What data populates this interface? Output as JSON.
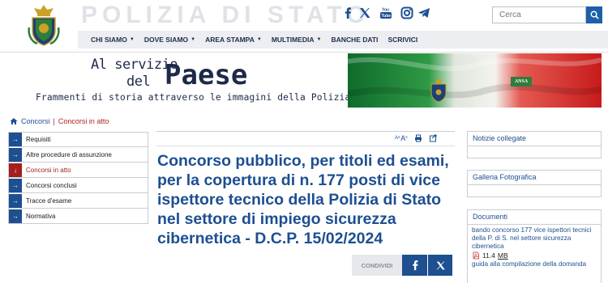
{
  "header": {
    "site_title": "POLIZIA DI STATO",
    "social_icons": [
      "facebook-icon",
      "x-icon",
      "youtube-icon",
      "instagram-icon",
      "telegram-icon"
    ],
    "search": {
      "placeholder": "Cerca"
    },
    "nav": [
      {
        "label": "CHI SIAMO",
        "dropdown": true
      },
      {
        "label": "DOVE SIAMO",
        "dropdown": true
      },
      {
        "label": "AREA STAMPA",
        "dropdown": true
      },
      {
        "label": "MULTIMEDIA",
        "dropdown": true
      },
      {
        "label": "BANCHE DATI",
        "dropdown": false
      },
      {
        "label": "SCRIVICI",
        "dropdown": false
      }
    ]
  },
  "banner": {
    "line1": "Al servizio",
    "line2_small": "del",
    "line2_big": "Paese",
    "line3": "Frammenti di storia attraverso le immagini della Polizia",
    "badge": "ANSA"
  },
  "breadcrumb": {
    "home_icon": "home-icon",
    "items": [
      "Concorsi",
      "Concorsi in atto"
    ]
  },
  "sidebar": {
    "items": [
      {
        "label": "Requisiti",
        "active": false
      },
      {
        "label": "Altre procedure di assunzione",
        "active": false
      },
      {
        "label": "Concorsi in atto",
        "active": true
      },
      {
        "label": "Concorsi conclusi",
        "active": false
      },
      {
        "label": "Tracce d'esame",
        "active": false
      },
      {
        "label": "Normativa",
        "active": false
      }
    ]
  },
  "main": {
    "tools": {
      "font_small": "A",
      "font_large": "A",
      "print_icon": "print-icon",
      "share_icon": "share-icon"
    },
    "title": "Concorso pubblico, per titoli ed esami, per la copertura di n. 177 posti di vice ispettore tecnico della Polizia di Stato nel settore di impiego sicurezza cibernetica - D.C.P. 15/02/2024",
    "share_label": "CONDIVIDI"
  },
  "right": {
    "related_title": "Notizie collegate",
    "gallery_title": "Galleria Fotografica",
    "documents_title": "Documenti",
    "documents": [
      {
        "title": "bando concorso 177 vice ispettori tecnici della P. di S. nel settore sicurezza cibernetica",
        "size": "11.4",
        "unit": "MB"
      },
      {
        "title": "guida alla compilazione della domanda"
      }
    ]
  },
  "colors": {
    "primary": "#1d4f91",
    "active": "#a51d1d",
    "nav_bg": "#eceef1"
  }
}
